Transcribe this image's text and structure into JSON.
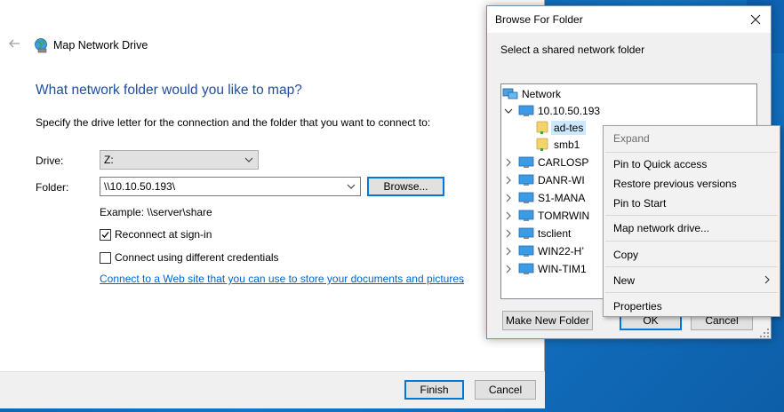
{
  "wizard": {
    "title": "Map Network Drive",
    "heading": "What network folder would you like to map?",
    "description": "Specify the drive letter for the connection and the folder that you want to connect to:",
    "drive_label": "Drive:",
    "drive_value": "Z:",
    "folder_label": "Folder:",
    "folder_value": "\\\\10.10.50.193\\",
    "browse_label": "Browse...",
    "example": "Example: \\\\server\\share",
    "reconnect_label": "Reconnect at sign-in",
    "reconnect_checked": true,
    "credentials_label": "Connect using different credentials",
    "credentials_checked": false,
    "link_text": "Connect to a Web site that you can use to store your documents and pictures",
    "link_suffix": ".",
    "finish_label": "Finish",
    "cancel_label": "Cancel"
  },
  "browse_dialog": {
    "title": "Browse For Folder",
    "instruction": "Select a shared network folder",
    "tree": [
      {
        "label": "Network",
        "level": 0,
        "icon": "network-icon",
        "expander": "none"
      },
      {
        "label": "10.10.50.193",
        "level": 1,
        "icon": "computer-icon",
        "expander": "expanded"
      },
      {
        "label": "ad-tes",
        "level": 2,
        "icon": "shared-folder-icon",
        "expander": "none",
        "selected": true
      },
      {
        "label": "smb1",
        "level": 2,
        "icon": "shared-folder-icon",
        "expander": "none"
      },
      {
        "label": "CARLOSP",
        "level": 1,
        "icon": "computer-icon",
        "expander": "collapsed"
      },
      {
        "label": "DANR-WI",
        "level": 1,
        "icon": "computer-icon",
        "expander": "collapsed"
      },
      {
        "label": "S1-MANA",
        "level": 1,
        "icon": "computer-icon",
        "expander": "collapsed"
      },
      {
        "label": "TOMRWIN",
        "level": 1,
        "icon": "computer-icon",
        "expander": "collapsed"
      },
      {
        "label": "tsclient",
        "level": 1,
        "icon": "computer-icon",
        "expander": "collapsed"
      },
      {
        "label": "WIN22-H’",
        "level": 1,
        "icon": "computer-icon",
        "expander": "collapsed"
      },
      {
        "label": "WIN-TIM1",
        "level": 1,
        "icon": "computer-icon",
        "expander": "collapsed"
      }
    ],
    "make_new_folder_label": "Make New Folder",
    "ok_label": "OK",
    "cancel_label": "Cancel"
  },
  "context_menu": {
    "items": [
      {
        "label": "Expand",
        "disabled": true
      },
      {
        "label": "Pin to Quick access"
      },
      {
        "label": "Restore previous versions"
      },
      {
        "label": "Pin to Start"
      },
      {
        "label": "Map network drive..."
      },
      {
        "label": "Copy"
      },
      {
        "label": "New",
        "submenu": true
      },
      {
        "label": "Properties"
      }
    ]
  },
  "colors": {
    "heading": "#1f4e9c",
    "link": "#0066cc",
    "accent": "#0078d7",
    "selection": "#cce8ff",
    "desktop": "#1476c6"
  }
}
